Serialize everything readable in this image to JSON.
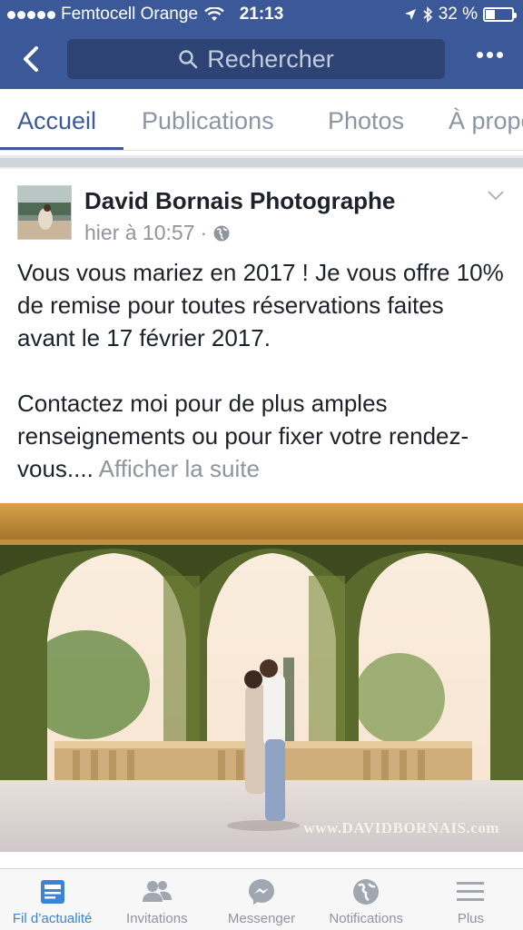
{
  "status_bar": {
    "carrier": "Femtocell Orange",
    "time": "21:13",
    "battery": "32 %",
    "battery_level": 0.32
  },
  "nav": {
    "search_placeholder": "Rechercher"
  },
  "tabs": [
    {
      "label": "Accueil",
      "active": true
    },
    {
      "label": "Publications",
      "active": false
    },
    {
      "label": "Photos",
      "active": false
    },
    {
      "label": "À propos",
      "active": false
    }
  ],
  "post": {
    "author": "David Bornais Photographe",
    "timestamp": "hier à 10:57",
    "privacy_icon": "globe-icon",
    "text_paragraph_1": "Vous vous mariez en 2017 ! Je vous offre 10% de remise pour toutes réservations faites avant le 17 février 2017.",
    "text_paragraph_2": "Contactez moi pour de plus amples renseignements ou pour fixer votre rendez-vous....",
    "see_more": "Afficher la suite",
    "watermark": "www.DAVIDBORNAIS.com"
  },
  "bottom_nav": [
    {
      "label": "Fil d’actualité",
      "icon": "news-feed-icon",
      "active": true
    },
    {
      "label": "Invitations",
      "icon": "friends-icon",
      "active": false
    },
    {
      "label": "Messenger",
      "icon": "messenger-icon",
      "active": false
    },
    {
      "label": "Notifications",
      "icon": "globe-notifications-icon",
      "active": false
    },
    {
      "label": "Plus",
      "icon": "menu-icon",
      "active": false
    }
  ],
  "colors": {
    "brand": "#3b5998",
    "active_tab_blue": "#3b82d8"
  }
}
